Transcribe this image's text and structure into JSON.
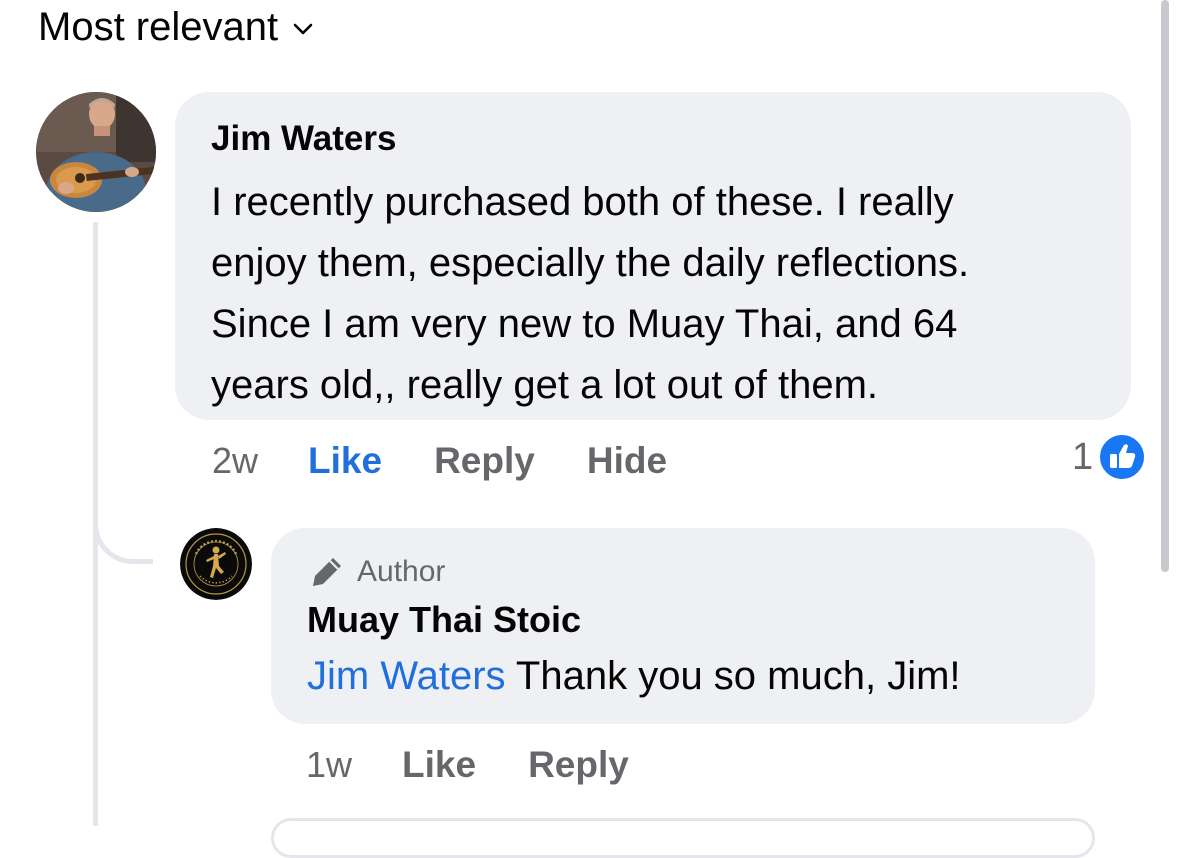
{
  "sort": {
    "label": "Most relevant",
    "icon": "chevron-down-icon"
  },
  "comments": [
    {
      "author": "Jim Waters",
      "avatar": "guitar-player-photo",
      "text_lines": [
        "I recently purchased both of these.  I really",
        "enjoy them, especially the daily reflections.",
        "Since I am very new to Muay Thai, and 64",
        "years old,, really get a lot out of them."
      ],
      "time": "2w",
      "like_label": "Like",
      "reply_label": "Reply",
      "hide_label": "Hide",
      "reaction_count": "1",
      "reaction_icon": "thumbs-up-icon",
      "liked": true
    }
  ],
  "reply": {
    "badge_icon": "pen-icon",
    "badge_label": "Author",
    "author": "Muay Thai Stoic",
    "avatar": "muay-thai-stoic-logo",
    "mention": "Jim Waters",
    "text": " Thank you so much, Jim!",
    "time": "1w",
    "like_label": "Like",
    "reply_label": "Reply"
  },
  "colors": {
    "link": "#216fdb",
    "bubble": "#eef0f3",
    "muted": "#65676b"
  }
}
